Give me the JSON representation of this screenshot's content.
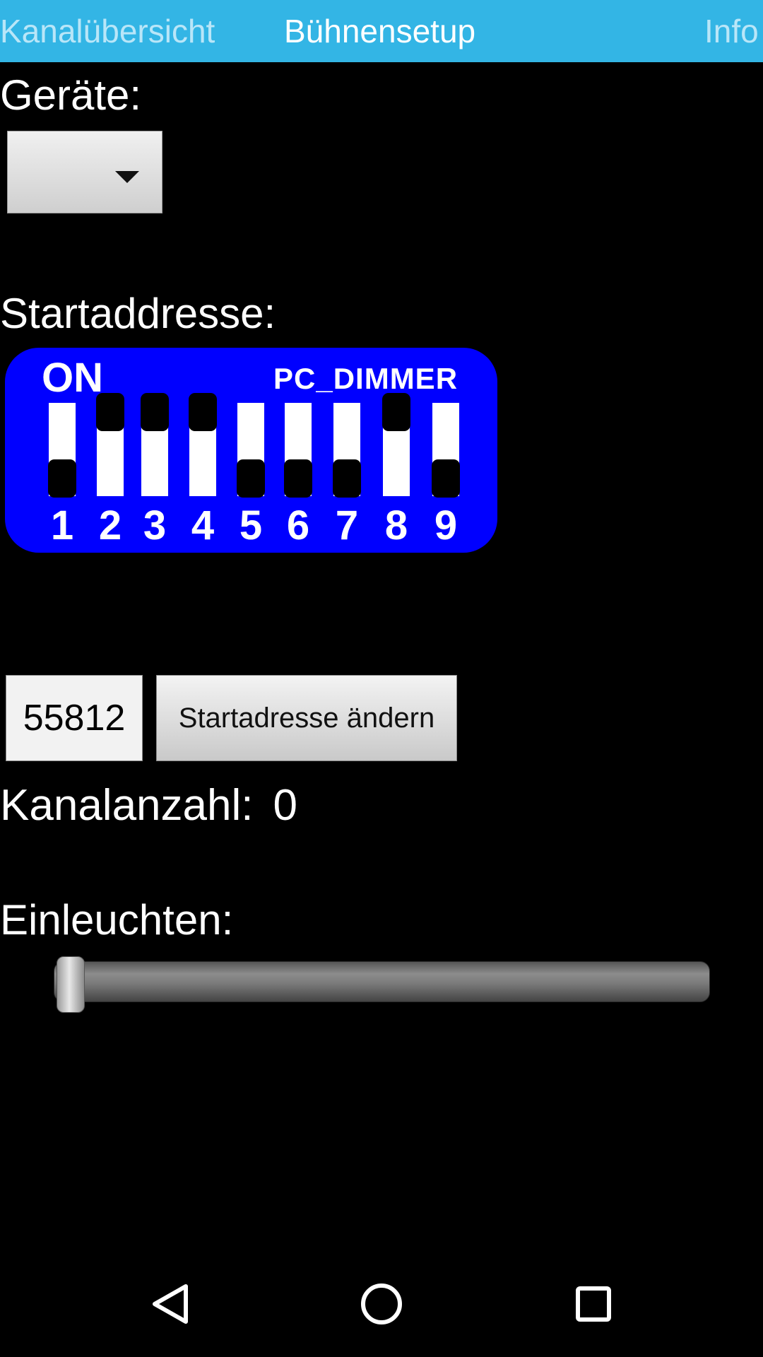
{
  "tabs": [
    {
      "label": "Kanalübersicht",
      "active": false
    },
    {
      "label": "Bühnensetup",
      "active": true
    },
    {
      "label": "Info",
      "active": false
    }
  ],
  "colors": {
    "tabbar_bg": "#33b5e5",
    "dip_bg": "#0000ff",
    "background": "#000000"
  },
  "labels": {
    "geraete": "Geräte:",
    "startaddresse": "Startaddresse:",
    "einleuchten": "Einleuchten:"
  },
  "device_spinner": {
    "selected": "",
    "icon": "chevron-down-icon"
  },
  "dip_switch": {
    "on_label": "ON",
    "brand": "PC_DIMMER",
    "switches": [
      {
        "number": "1",
        "on": false
      },
      {
        "number": "2",
        "on": true
      },
      {
        "number": "3",
        "on": true
      },
      {
        "number": "4",
        "on": true
      },
      {
        "number": "5",
        "on": false
      },
      {
        "number": "6",
        "on": false
      },
      {
        "number": "7",
        "on": false
      },
      {
        "number": "8",
        "on": true
      },
      {
        "number": "9",
        "on": false
      }
    ]
  },
  "address": {
    "value": "55812",
    "button_label": "Startadresse ändern"
  },
  "kanalanzahl": {
    "label": "Kanalanzahl:",
    "value": "0"
  },
  "slider": {
    "value": 0.0
  },
  "navbar": {
    "back_icon": "back-triangle-icon",
    "home_icon": "home-circle-icon",
    "recent_icon": "recent-apps-square-icon"
  }
}
